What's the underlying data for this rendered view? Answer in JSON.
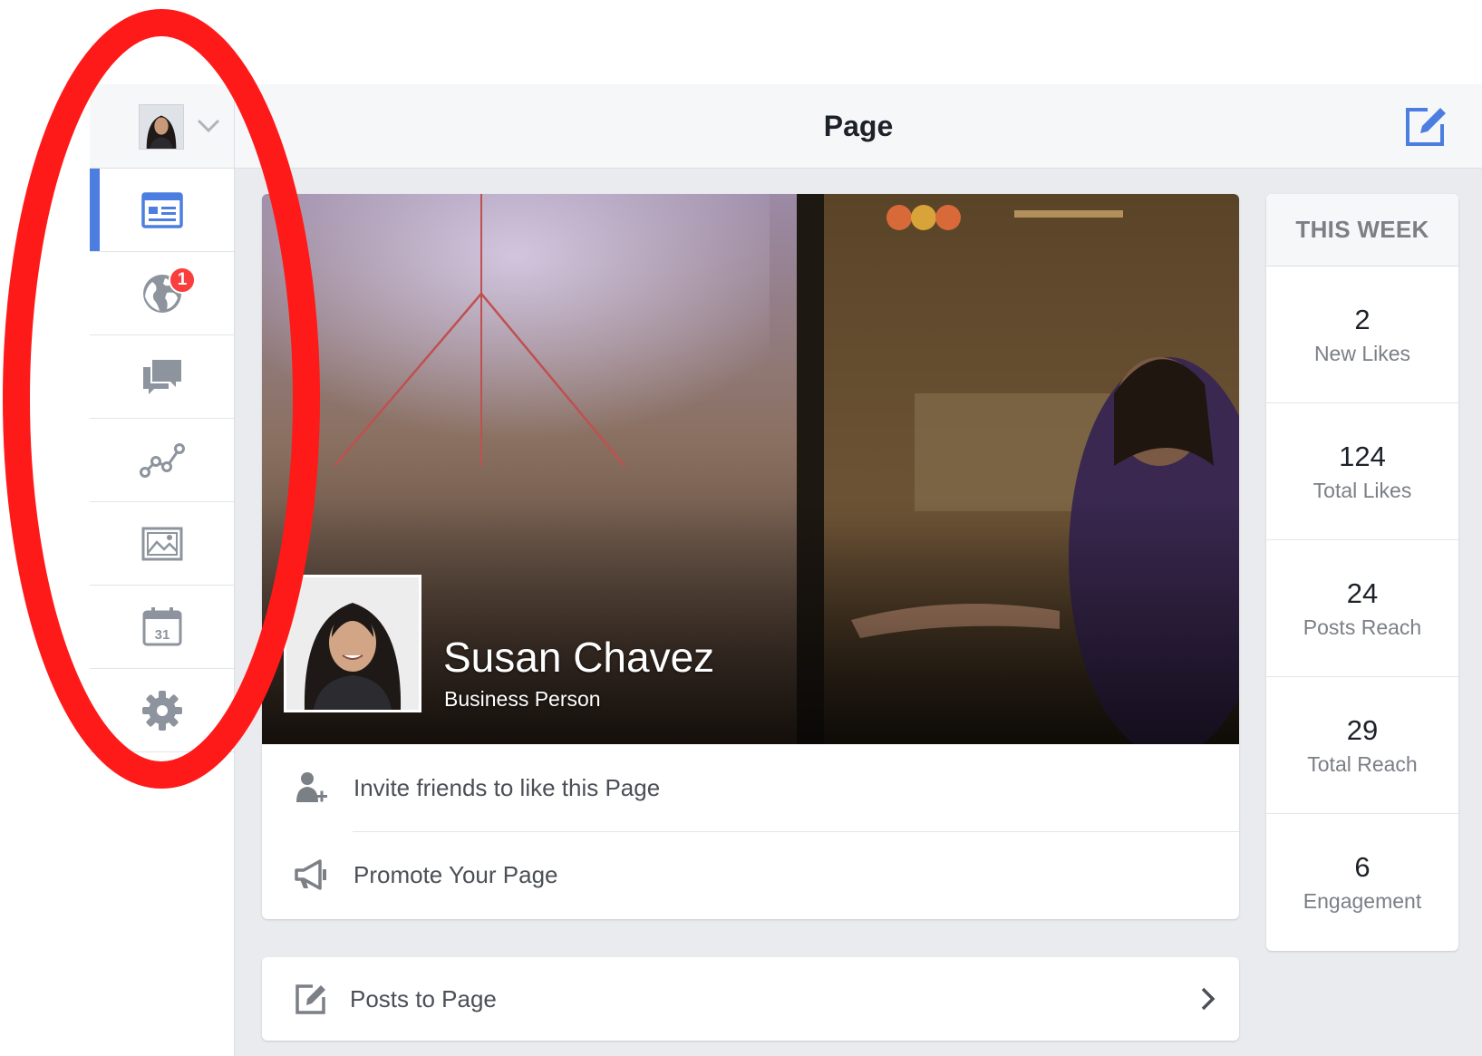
{
  "header": {
    "title": "Page"
  },
  "sidebar": {
    "items": [
      {
        "icon": "page-icon",
        "active": true
      },
      {
        "icon": "globe-icon",
        "badge": "1"
      },
      {
        "icon": "messages-icon"
      },
      {
        "icon": "insights-icon"
      },
      {
        "icon": "photos-icon"
      },
      {
        "icon": "calendar-icon",
        "text": "31"
      },
      {
        "icon": "gear-icon"
      }
    ]
  },
  "cover": {
    "name": "Susan Chavez",
    "role": "Business Person"
  },
  "actions": [
    {
      "label": "Invite friends to like this Page",
      "icon": "invite-friend-icon"
    },
    {
      "label": "Promote Your Page",
      "icon": "megaphone-icon"
    }
  ],
  "posts": {
    "label": "Posts to Page",
    "icon": "compose-icon"
  },
  "this_week": {
    "title": "THIS WEEK",
    "stats": [
      {
        "value": "2",
        "label": "New Likes"
      },
      {
        "value": "124",
        "label": "Total Likes"
      },
      {
        "value": "24",
        "label": "Posts Reach"
      },
      {
        "value": "29",
        "label": "Total Reach"
      },
      {
        "value": "6",
        "label": "Engagement"
      }
    ]
  },
  "colors": {
    "accent": "#4c7ee1",
    "badge": "#fa3e3e",
    "annotation": "#ff1a1a",
    "icon_gray": "#8d949e"
  }
}
